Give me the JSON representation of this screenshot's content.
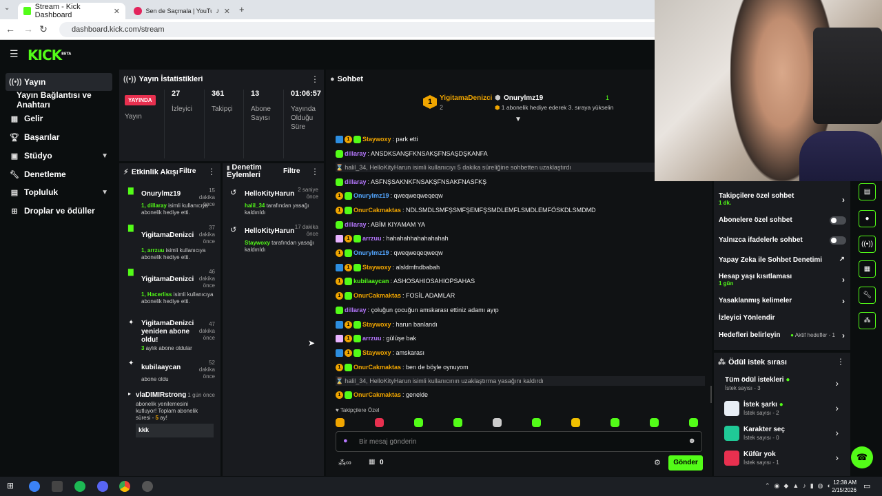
{
  "browser": {
    "tabs": [
      {
        "label": "Stream - Kick Dashboard"
      },
      {
        "label": "Sen de Saçmala | YouTube"
      }
    ],
    "url": "dashboard.kick.com/stream"
  },
  "logo": "KICK",
  "logo_beta": "BETA",
  "sidebar": {
    "items": [
      {
        "label": "Yayın",
        "icon": "broadcast-icon"
      },
      {
        "label": "Yayın Bağlantısı ve Anahtarı",
        "icon": ""
      },
      {
        "label": "Gelir",
        "icon": "revenue-icon"
      },
      {
        "label": "Başarılar",
        "icon": "trophy-icon"
      },
      {
        "label": "Stüdyo",
        "icon": "studio-icon"
      },
      {
        "label": "Denetleme",
        "icon": "wrench-icon"
      },
      {
        "label": "Topluluk",
        "icon": "community-icon"
      },
      {
        "label": "Droplar ve ödüller",
        "icon": "drops-icon"
      }
    ]
  },
  "stats": {
    "title": "Yayın İstatistikleri",
    "live_badge": "YAYINDA",
    "live_label": "Yayın",
    "cols": [
      {
        "value": "27",
        "label": "İzleyici"
      },
      {
        "value": "361",
        "label": "Takipçi"
      },
      {
        "value": "13",
        "label": "Abone Sayısı"
      },
      {
        "value": "01:06:57",
        "label": "Yayında Olduğu Süre"
      }
    ]
  },
  "activity": {
    "title": "Etkinlik Akışı",
    "filter": "Filtre",
    "items": [
      {
        "name": "Onurylmz19",
        "time": "15 dakika önce",
        "hl": "1, dillaray",
        "text": " isimli kullanıcıya abonelik hediye etti."
      },
      {
        "name": "YigitamaDenizci",
        "time": "37 dakika önce",
        "hl": "1, arrzuu",
        "text": " isimli kullanıcıya abonelik hediye etti."
      },
      {
        "name": "YigitamaDenizci",
        "time": "46 dakika önce",
        "hl": "1, Hacerliss",
        "text": " isimli kullanıcıya abonelik hediye etti."
      },
      {
        "name": "YigitamaDenizci yeniden abone oldu!",
        "time": "47 dakika önce",
        "hl": "3",
        "text": " aylık abone oldular"
      },
      {
        "name": "kubilaaycan",
        "time": "52 dakika önce",
        "hl": "",
        "text": "abone oldu"
      },
      {
        "name": "vlaDIMIRstrong",
        "time": "1 gün önce",
        "hl": "",
        "text": "abonelik yenilemesini kutluyor! Toplam abonelik süresi - ",
        "hl2": "5",
        "text2": " ay!",
        "extra": "kkk"
      }
    ]
  },
  "moderation": {
    "title": "Denetim Eylemleri",
    "filter": "Filtre",
    "items": [
      {
        "name": "HelloKityHarun",
        "time": "2 saniye önce",
        "hl": "halil_34",
        "text": " tarafından yasağı kaldırıldı"
      },
      {
        "name": "HelloKityHarun",
        "time": "17 dakika önce",
        "hl": "Staywoxy",
        "text": " tarafından yasağı kaldırıldı"
      }
    ]
  },
  "chat": {
    "title": "Sohbet",
    "pinned": {
      "user1": "YigitamaDenizci",
      "count1": "2",
      "user2": "Onurylmz19",
      "count2": "1",
      "note": "1 abonelik hediye ederek 3. sıraya yükselin"
    },
    "messages": [
      {
        "user": "Staywoxy",
        "color": "#f0a500",
        "text": ": park etti",
        "badges": [
          "mod",
          "sub",
          "grn"
        ]
      },
      {
        "user": "dillaray",
        "color": "#b678ff",
        "text": ": ANSDKSANŞFKNSAKŞFNSAŞDŞKANFA",
        "badges": [
          "grn"
        ]
      },
      {
        "sys": true,
        "text": "halil_34, HelloKityHarun isimli kullanıcıyı 5 dakika süreliğine sohbetten uzaklaştırdı"
      },
      {
        "user": "dillaray",
        "color": "#b678ff",
        "text": ": ASFNŞSAKNKFNSAKŞFNSAKFNASFKŞ",
        "badges": [
          "grn"
        ]
      },
      {
        "user": "Onurylmz19",
        "color": "#53a6ff",
        "text": ": qweqweqweqeqw",
        "badges": [
          "sub",
          "grn"
        ]
      },
      {
        "user": "OnurCakmaktas",
        "color": "#f0a500",
        "text": ": NDLSMDLSMFŞSMFŞEMFŞSMDLEMFLSMDLEMFÖSKDLSMDMD",
        "badges": [
          "sub",
          "grn"
        ]
      },
      {
        "user": "dillaray",
        "color": "#b678ff",
        "text": ": ABİM KIYAMAM YA",
        "badges": [
          "grn"
        ]
      },
      {
        "user": "arrzuu",
        "color": "#b678ff",
        "text": ": hahahahhahahahahah",
        "badges": [
          "vip",
          "sub",
          "grn"
        ]
      },
      {
        "user": "Onurylmz19",
        "color": "#53a6ff",
        "text": ": qweqweqeqweqw",
        "badges": [
          "sub",
          "grn"
        ]
      },
      {
        "user": "Staywoxy",
        "color": "#f0a500",
        "text": ": alsldmfndbabah",
        "badges": [
          "mod",
          "sub",
          "grn"
        ]
      },
      {
        "user": "kubilaaycan",
        "color": "#53fc18",
        "text": ": ASHOSAHIOSAHIOPSAHAS",
        "badges": [
          "sub",
          "grn"
        ]
      },
      {
        "user": "OnurCakmaktas",
        "color": "#f0a500",
        "text": ": FOSİL ADAMLAR",
        "badges": [
          "sub",
          "grn"
        ]
      },
      {
        "user": "dillaray",
        "color": "#b678ff",
        "text": ": çoluğun çocuğun amskarası ettiniz adamı ayıp",
        "badges": [
          "grn"
        ]
      },
      {
        "user": "Staywoxy",
        "color": "#f0a500",
        "text": ": harun banlandı",
        "badges": [
          "mod",
          "sub",
          "grn"
        ]
      },
      {
        "user": "arrzuu",
        "color": "#b678ff",
        "text": ": gülüşe bak",
        "badges": [
          "vip",
          "sub",
          "grn"
        ]
      },
      {
        "user": "Staywoxy",
        "color": "#f0a500",
        "text": ": amskarası",
        "badges": [
          "mod",
          "sub",
          "grn"
        ]
      },
      {
        "user": "OnurCakmaktas",
        "color": "#f0a500",
        "text": ": ben de böyle oynuyom",
        "badges": [
          "sub",
          "grn"
        ]
      },
      {
        "sys": true,
        "text": "halil_34, HelloKityHarun isimli kullanıcının uzaklaştırma yasağını kaldırdı"
      },
      {
        "user": "OnurCakmaktas",
        "color": "#f0a500",
        "text": ": genelde",
        "badges": [
          "sub",
          "grn"
        ]
      }
    ],
    "followers_only": "Takipçilere Özel",
    "input_placeholder": "Bir mesaj gönderin",
    "points": "0",
    "send": "Gönder"
  },
  "settings": {
    "rows": [
      {
        "label": "Takipçilere özel sohbet",
        "sub": "1 dk.",
        "type": "arrow"
      },
      {
        "label": "Abonelere özel sohbet",
        "type": "toggle"
      },
      {
        "label": "Yalnızca ifadelerle sohbet",
        "type": "toggle"
      },
      {
        "label": "Yapay Zeka ile Sohbet Denetimi",
        "type": "ext"
      },
      {
        "label": "Hesap yaşı kısıtlaması",
        "sub": "1 gün",
        "type": "arrow"
      },
      {
        "label": "Yasaklanmış kelimeler",
        "type": "arrow"
      },
      {
        "label": "İzleyici Yönlendir",
        "type": "none"
      },
      {
        "label": "Hedefleri belirleyin",
        "right": "Aktif hedefler - 1",
        "type": "arrow"
      }
    ]
  },
  "rewards": {
    "title": "Ödül istek sırası",
    "items": [
      {
        "name": "Tüm ödül istekleri",
        "sub": "İstek sayısı - 3",
        "color": ""
      },
      {
        "name": "İstek şarkı",
        "sub": "İstek sayısı - 2",
        "color": "#e8eef5"
      },
      {
        "name": "Karakter seç",
        "sub": "İstek sayısı - 0",
        "color": "#20c997"
      },
      {
        "name": "Küfür yok",
        "sub": "İstek sayısı - 1",
        "color": "#e8304f"
      }
    ]
  },
  "taskbar": {
    "time": "12:38 AM",
    "date": "2/15/2026"
  }
}
